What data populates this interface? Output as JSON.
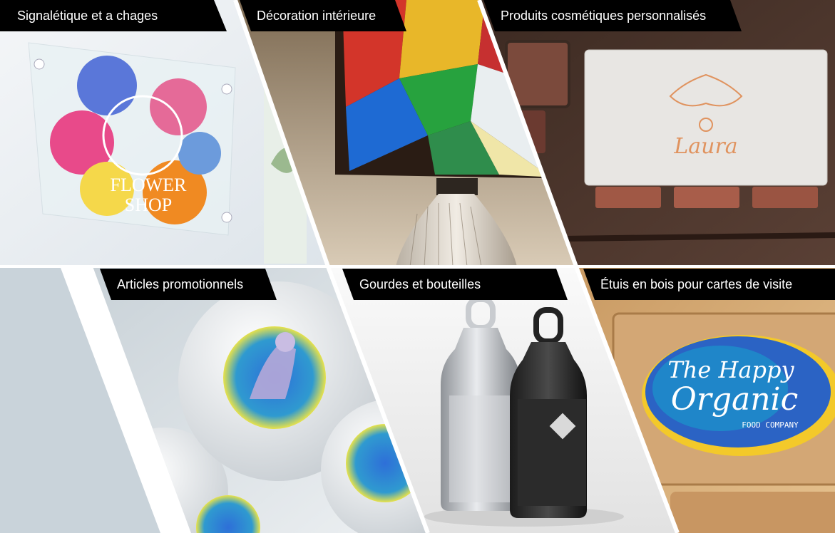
{
  "categories": [
    {
      "label": "Signalétique et a chages",
      "image_text": [
        "FLOWER",
        "SHOP"
      ]
    },
    {
      "label": "Décoration intérieure"
    },
    {
      "label": "Produits cosmétiques personnalisés",
      "image_text": [
        "Laura"
      ]
    },
    {
      "label": "Articles promotionnels"
    },
    {
      "label": "Gourdes et bouteilles"
    },
    {
      "label": "Étuis en bois pour cartes de visite",
      "image_text": [
        "The Happy",
        "Organic",
        "FOOD COMPANY"
      ]
    }
  ],
  "colors": {
    "label_bg": "#000000",
    "label_text": "#ffffff",
    "left_strip": "#c9d3da",
    "divider": "#ffffff"
  }
}
